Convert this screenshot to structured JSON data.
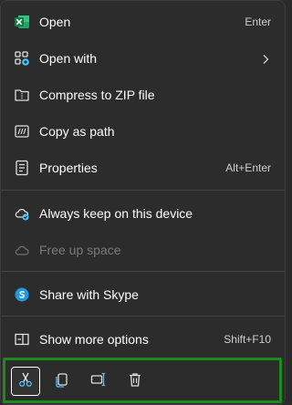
{
  "menu": {
    "items": [
      {
        "label": "Open",
        "shortcut": "Enter",
        "icon": "excel-icon"
      },
      {
        "label": "Open with",
        "icon": "open-with-icon",
        "submenu": true
      },
      {
        "label": "Compress to ZIP file",
        "icon": "zip-folder-icon"
      },
      {
        "label": "Copy as path",
        "icon": "copy-path-icon"
      },
      {
        "label": "Properties",
        "shortcut": "Alt+Enter",
        "icon": "properties-icon"
      },
      {
        "label": "Always keep on this device",
        "icon": "cloud-sync-icon"
      },
      {
        "label": "Free up space",
        "icon": "cloud-icon",
        "disabled": true
      },
      {
        "label": "Share with Skype",
        "icon": "skype-icon"
      },
      {
        "label": "Show more options",
        "shortcut": "Shift+F10",
        "icon": "show-more-icon"
      }
    ]
  },
  "toolbar": {
    "buttons": [
      {
        "icon": "cut-icon",
        "selected": true
      },
      {
        "icon": "copy-icon"
      },
      {
        "icon": "rename-icon"
      },
      {
        "icon": "delete-icon"
      }
    ]
  },
  "colors": {
    "menu_bg": "#2c2c2c",
    "highlight_border": "#1d8a1d",
    "excel_green": "#1f7244",
    "accent_blue": "#4cc2ff",
    "skype_blue": "#1b9ae6"
  }
}
